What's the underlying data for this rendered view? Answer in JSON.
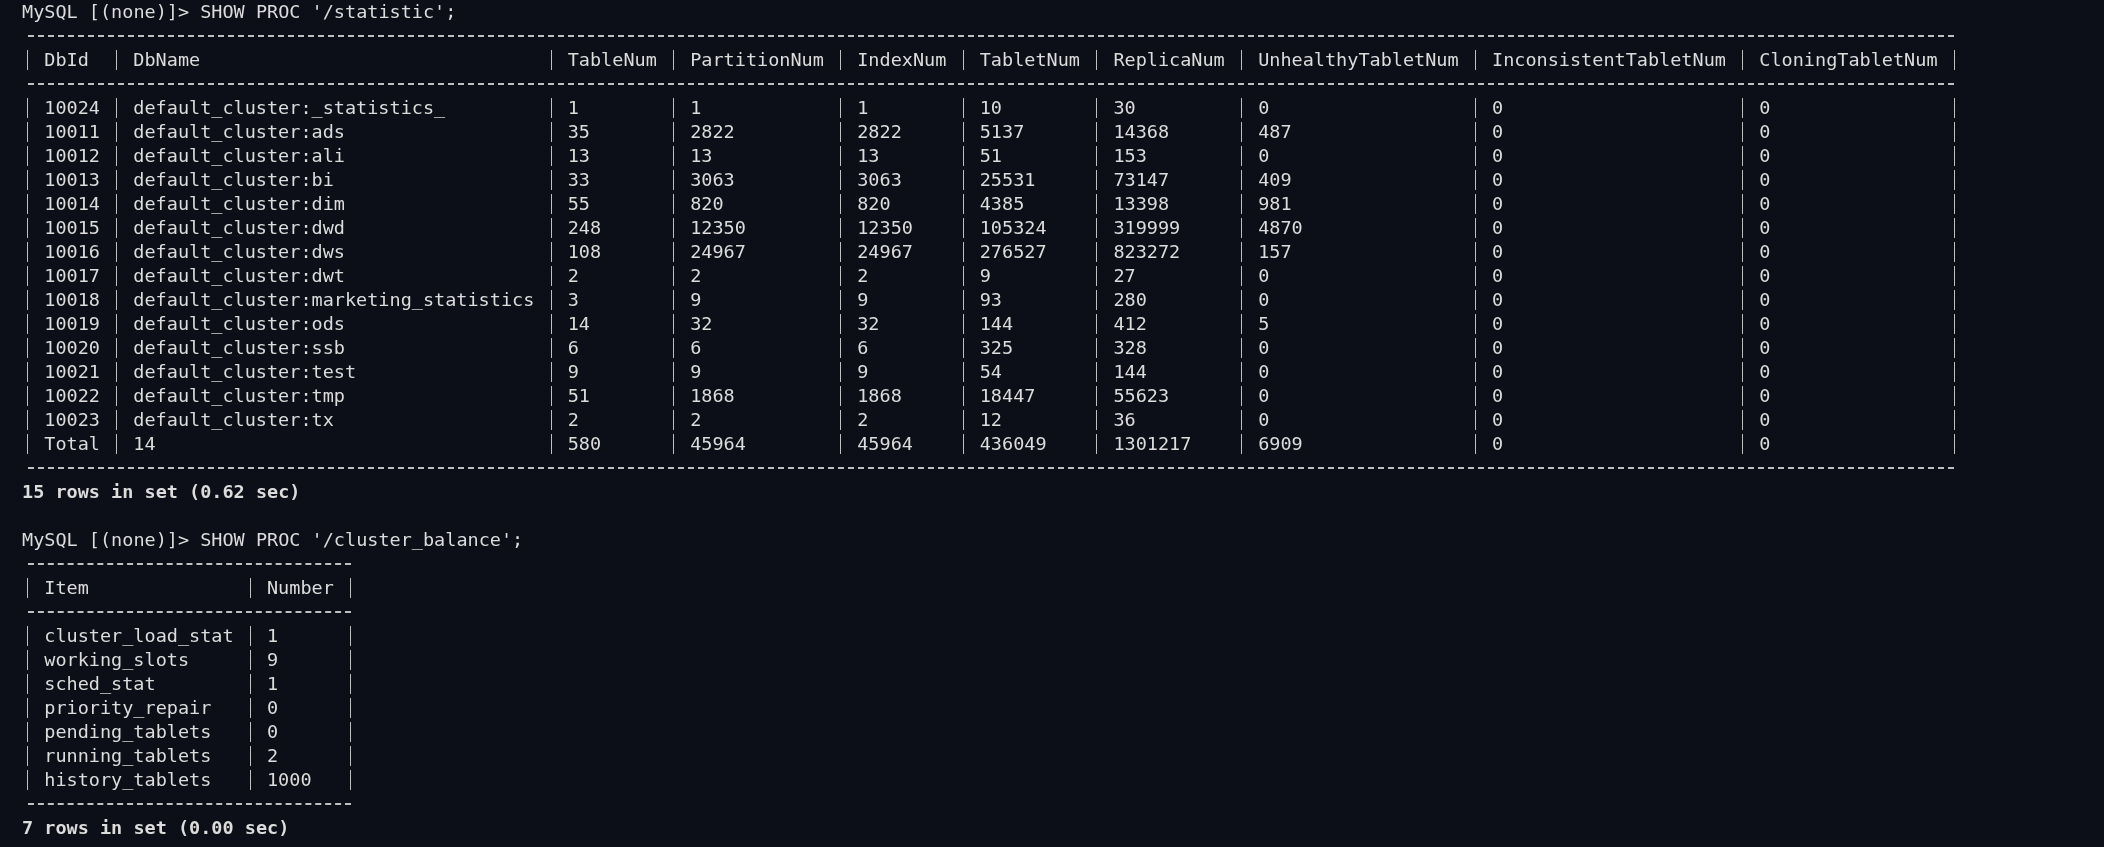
{
  "queries": [
    {
      "input": "MySQL [(none)]> SHOW PROC '/statistic';",
      "columns": [
        "DbId",
        "DbName",
        "TableNum",
        "PartitionNum",
        "IndexNum",
        "TabletNum",
        "ReplicaNum",
        "UnhealthyTabletNum",
        "InconsistentTabletNum",
        "CloningTabletNum"
      ],
      "rows": [
        [
          "10024",
          "default_cluster:_statistics_",
          "1",
          "1",
          "1",
          "10",
          "30",
          "0",
          "0",
          "0"
        ],
        [
          "10011",
          "default_cluster:ads",
          "35",
          "2822",
          "2822",
          "5137",
          "14368",
          "487",
          "0",
          "0"
        ],
        [
          "10012",
          "default_cluster:ali",
          "13",
          "13",
          "13",
          "51",
          "153",
          "0",
          "0",
          "0"
        ],
        [
          "10013",
          "default_cluster:bi",
          "33",
          "3063",
          "3063",
          "25531",
          "73147",
          "409",
          "0",
          "0"
        ],
        [
          "10014",
          "default_cluster:dim",
          "55",
          "820",
          "820",
          "4385",
          "13398",
          "981",
          "0",
          "0"
        ],
        [
          "10015",
          "default_cluster:dwd",
          "248",
          "12350",
          "12350",
          "105324",
          "319999",
          "4870",
          "0",
          "0"
        ],
        [
          "10016",
          "default_cluster:dws",
          "108",
          "24967",
          "24967",
          "276527",
          "823272",
          "157",
          "0",
          "0"
        ],
        [
          "10017",
          "default_cluster:dwt",
          "2",
          "2",
          "2",
          "9",
          "27",
          "0",
          "0",
          "0"
        ],
        [
          "10018",
          "default_cluster:marketing_statistics",
          "3",
          "9",
          "9",
          "93",
          "280",
          "0",
          "0",
          "0"
        ],
        [
          "10019",
          "default_cluster:ods",
          "14",
          "32",
          "32",
          "144",
          "412",
          "5",
          "0",
          "0"
        ],
        [
          "10020",
          "default_cluster:ssb",
          "6",
          "6",
          "6",
          "325",
          "328",
          "0",
          "0",
          "0"
        ],
        [
          "10021",
          "default_cluster:test",
          "9",
          "9",
          "9",
          "54",
          "144",
          "0",
          "0",
          "0"
        ],
        [
          "10022",
          "default_cluster:tmp",
          "51",
          "1868",
          "1868",
          "18447",
          "55623",
          "0",
          "0",
          "0"
        ],
        [
          "10023",
          "default_cluster:tx",
          "2",
          "2",
          "2",
          "12",
          "36",
          "0",
          "0",
          "0"
        ],
        [
          "Total",
          "14",
          "580",
          "45964",
          "45964",
          "436049",
          "1301217",
          "6909",
          "0",
          "0"
        ]
      ],
      "footer": "15 rows in set (0.62 sec)"
    },
    {
      "input": "MySQL [(none)]> SHOW PROC '/cluster_balance';",
      "columns": [
        "Item",
        "Number"
      ],
      "rows": [
        [
          "cluster_load_stat",
          "1"
        ],
        [
          "working_slots",
          "9"
        ],
        [
          "sched_stat",
          "1"
        ],
        [
          "priority_repair",
          "0"
        ],
        [
          "pending_tablets",
          "0"
        ],
        [
          "running_tablets",
          "2"
        ],
        [
          "history_tablets",
          "1000"
        ]
      ],
      "footer": "7 rows in set (0.00 sec)"
    }
  ]
}
